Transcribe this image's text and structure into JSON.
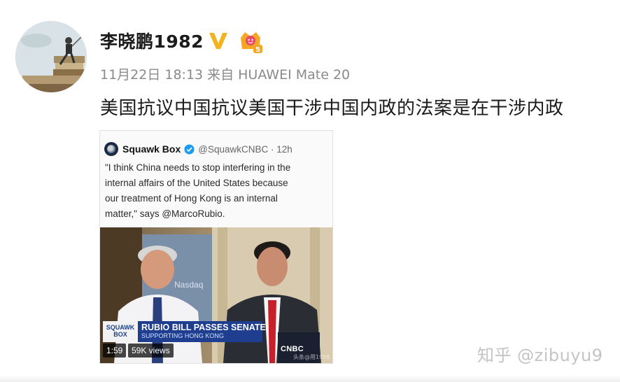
{
  "post": {
    "username": "李晓鹏1982",
    "date": "11月22日",
    "time": "18:13",
    "source_prefix": "来自",
    "source_device": "HUAWEI Mate 20",
    "text": "美国抗议中国抗议美国干涉中国内政的法案是在干涉内政",
    "vip_level": "5",
    "verified_color": "#f2b31c"
  },
  "tweet": {
    "name": "Squawk Box",
    "handle": "@SquawkCNBC · 12h",
    "lines": [
      "\"I think China needs to stop interfering in the",
      "internal affairs of the United States because",
      "our treatment of Hong Kong is an internal",
      "matter,\" says @MarcoRubio."
    ],
    "verified_color": "#1d9bf0"
  },
  "video": {
    "show_logo": "SQUAWK BOX",
    "headline": "RUBIO BILL PASSES SENATE",
    "subhead": "SUPPORTING HONG KONG",
    "duration": "1:59",
    "views": "59K views",
    "network": "CNBC",
    "nasdaq_sign": "Nasdaq",
    "image_watermark": "头条@用1958"
  },
  "watermark": "知乎 @zibuyu9"
}
